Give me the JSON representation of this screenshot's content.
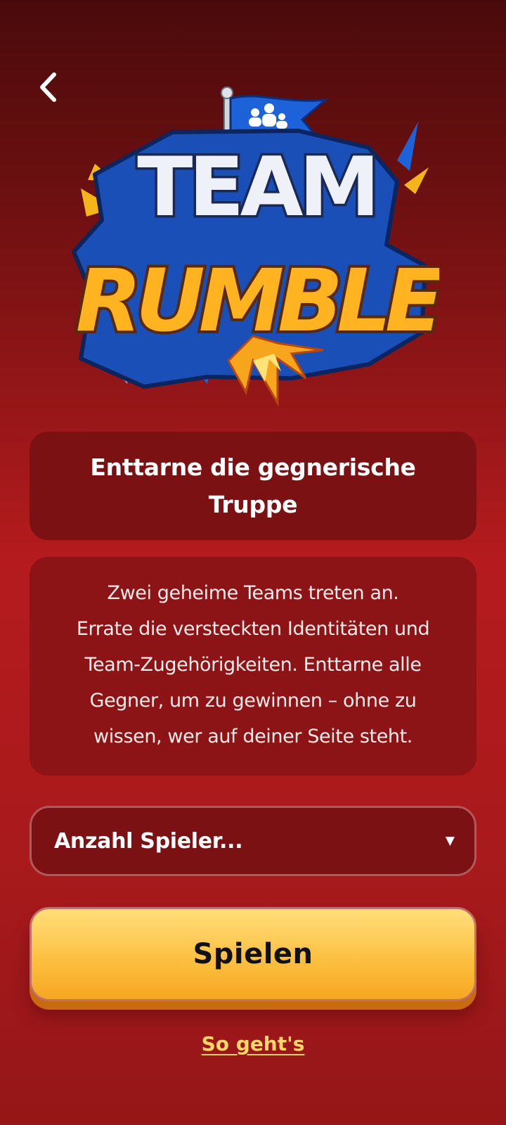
{
  "header": {
    "back_icon": "chevron-left-icon"
  },
  "logo": {
    "line1": "TEAM",
    "line2": "RUMBLE",
    "flag_icon": "group-icon"
  },
  "headline": "Enttarne die gegnerische Truppe",
  "description": "Zwei geheime Teams treten an.\nErrate die versteckten Identitäten und Team-Zugehörigkeiten. Enttarne alle Gegner, um zu gewinnen – ohne zu wissen, wer auf deiner Seite steht.",
  "player_select": {
    "placeholder": "Anzahl Spieler...",
    "caret_icon": "caret-down-icon"
  },
  "play_button": {
    "label": "Spielen"
  },
  "how_to_link": {
    "label": "So geht's"
  },
  "colors": {
    "background_top": "#4a0a0b",
    "background_mid": "#b51b1e",
    "card": "#7c1113",
    "button_yellow": "#fcc043",
    "link_yellow": "#ffd767"
  }
}
